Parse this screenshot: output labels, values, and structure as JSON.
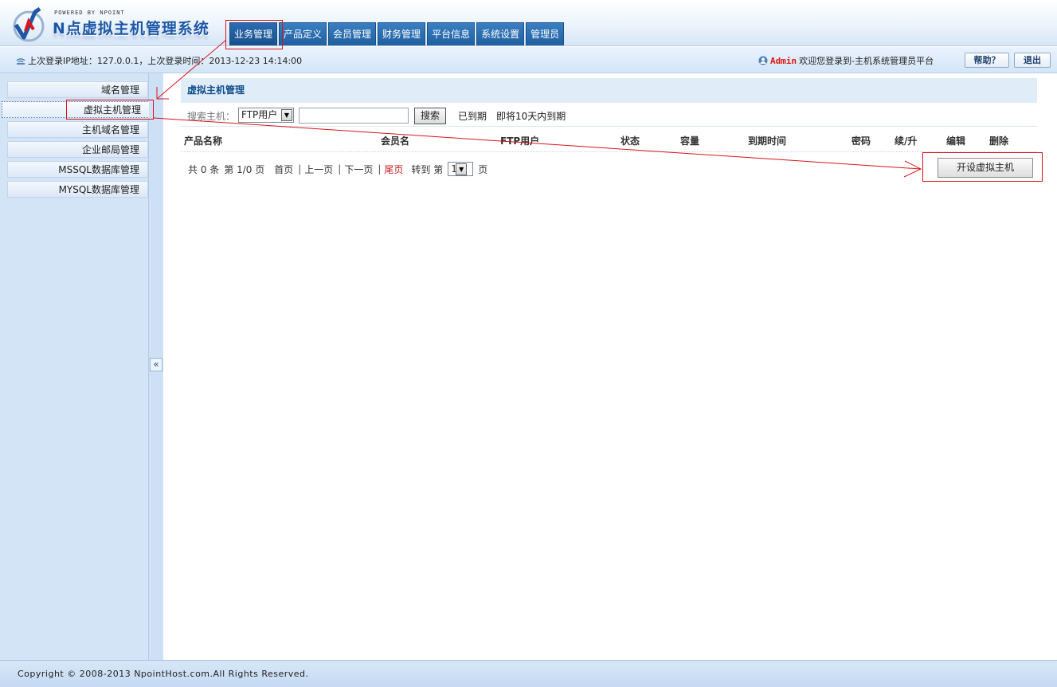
{
  "header": {
    "powered_by": "POWERED BY NPOINT",
    "system_name": "N点虚拟主机管理系统",
    "nav_tabs": [
      "业务管理",
      "产品定义",
      "会员管理",
      "财务管理",
      "平台信息",
      "系统设置",
      "管理员"
    ],
    "active_tab": "业务管理"
  },
  "infobar": {
    "last_login": "上次登录IP地址：127.0.0.1，上次登录时间：2013-12-23 14:14:00",
    "admin_name": "Admin",
    "welcome": "欢迎您登录到-主机系统管理员平台",
    "help_label": "帮助？",
    "logout_label": "退出"
  },
  "sidebar": {
    "items": [
      "域名管理",
      "虚拟主机管理",
      "主机域名管理",
      "企业邮局管理",
      "MSSQL数据库管理",
      "MYSQL数据库管理"
    ],
    "active_item": "虚拟主机管理",
    "collapse_label": "«"
  },
  "main": {
    "title": "虚拟主机管理",
    "search": {
      "label": "搜索主机：",
      "select_value": "FTP用户",
      "input_value": "",
      "button_label": "搜索",
      "expired_label": "已到期",
      "expiring_label": "即将10天内到期"
    },
    "table": {
      "columns": [
        "产品名称",
        "会员名",
        "FTP用户",
        "状态",
        "容量",
        "到期时间",
        "密码",
        "续/升",
        "编辑",
        "删除"
      ],
      "rows": []
    },
    "pager": {
      "total": "共 0 条",
      "page": "第 1/0 页",
      "first": "首页",
      "prev": "上一页",
      "next": "下一页",
      "last": "尾页",
      "goto_prefix": "转到 第",
      "page_value": "1",
      "goto_suffix": "页"
    },
    "open_button_label": "开设虚拟主机"
  },
  "footer": {
    "copyright": "Copyright © 2008-2013 NpointHost.com.All Rights Reserved."
  },
  "colors": {
    "nav_tab": "#1f5f9f",
    "annotation": "#d9141b",
    "admin_name": "#e0140c",
    "panel_title": "#0f4e8a"
  }
}
